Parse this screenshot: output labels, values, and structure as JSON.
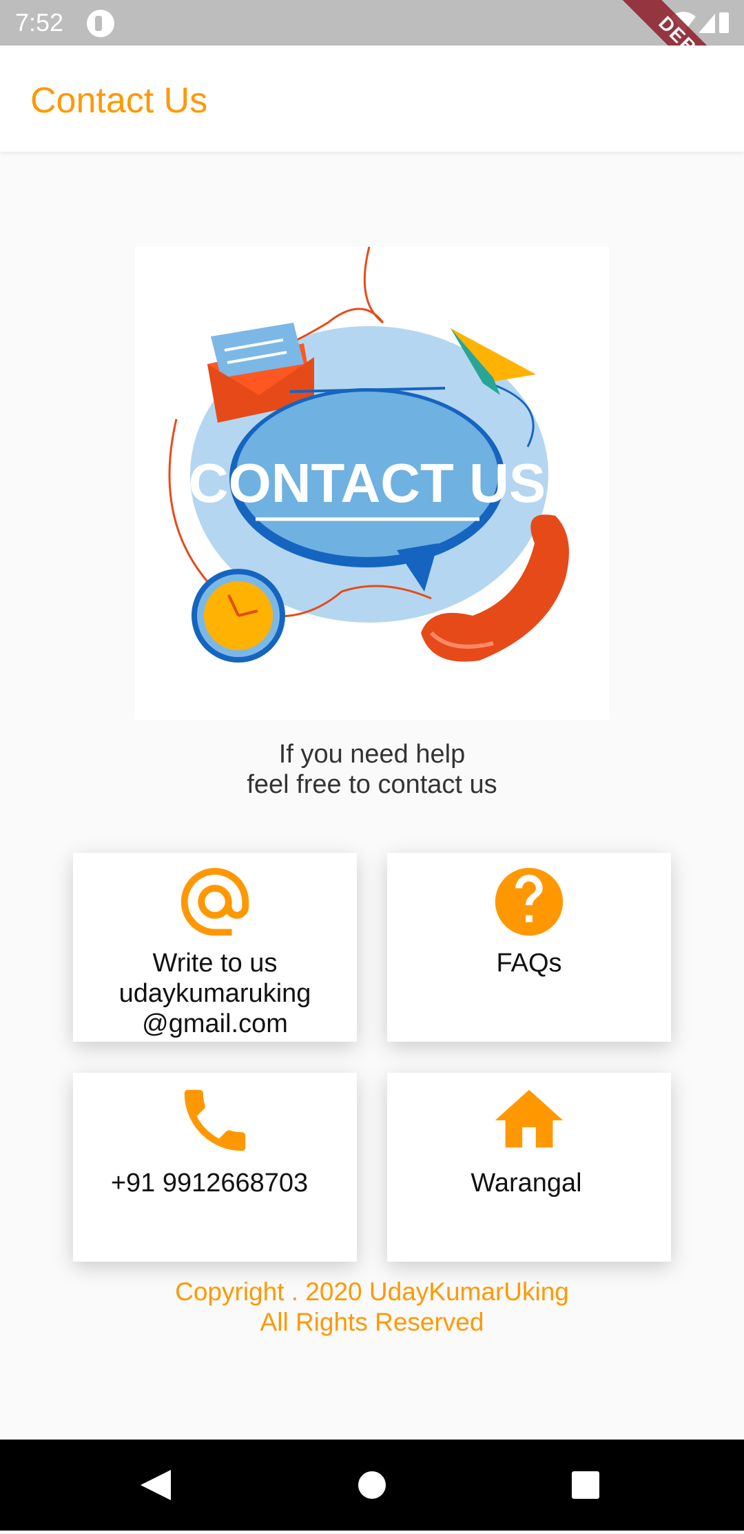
{
  "status_bar": {
    "time": "7:52",
    "debug_label": "DEBUG"
  },
  "app_bar": {
    "title": "Contact Us"
  },
  "hero": {
    "banner_text": "CONTACT US"
  },
  "help": {
    "line1": "If you need help",
    "line2": "feel free to contact us"
  },
  "cards": {
    "email": {
      "line1": "Write to us",
      "line2": "udaykumaruking",
      "line3": "@gmail.com",
      "icon": "at-icon"
    },
    "faq": {
      "label": "FAQs",
      "icon": "help-icon"
    },
    "phone": {
      "label": "+91 9912668703",
      "icon": "phone-icon"
    },
    "location": {
      "label": "Warangal",
      "icon": "home-icon"
    }
  },
  "footer": {
    "line1": "Copyright . 2020 UdayKumarUking",
    "line2": "All Rights Reserved"
  },
  "colors": {
    "accent": "#ff9800",
    "status_bar": "#bdbdbd",
    "nav_bar": "#000000"
  }
}
